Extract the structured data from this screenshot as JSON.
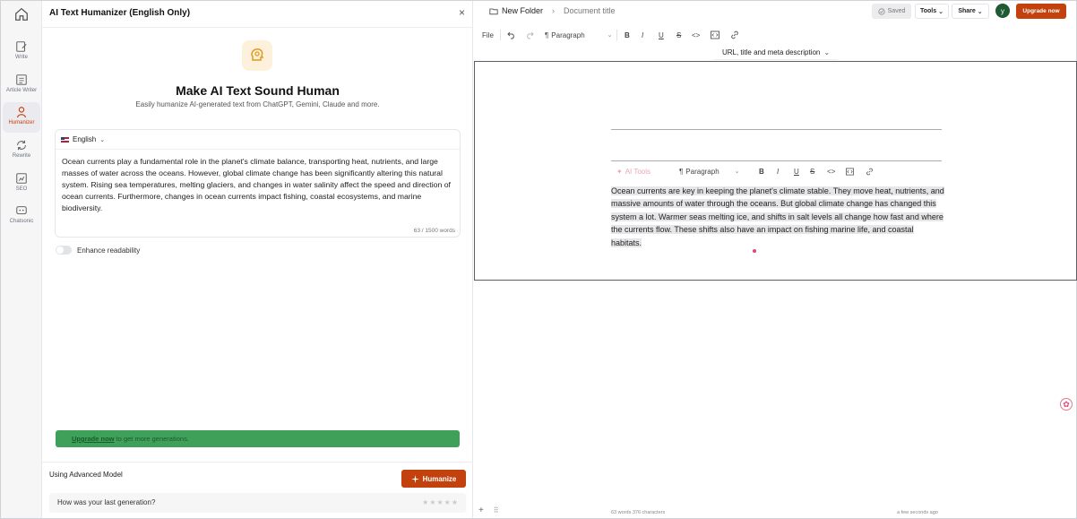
{
  "rail": {
    "items": [
      {
        "label": "Write",
        "icon": "write-icon"
      },
      {
        "label": "Article Writer",
        "icon": "article-icon"
      },
      {
        "label": "Humanizer",
        "icon": "humanizer-icon",
        "active": true
      },
      {
        "label": "Rewrite",
        "icon": "rewrite-icon"
      },
      {
        "label": "SEO",
        "icon": "seo-icon"
      },
      {
        "label": "Chatsonic",
        "icon": "chat-icon"
      }
    ]
  },
  "panel": {
    "title": "AI Text Humanizer (English Only)",
    "close": "×",
    "hero_title": "Make AI Text Sound Human",
    "hero_subtitle": "Easily humanize AI-generated text from ChatGPT, Gemini, Claude and more.",
    "language": "English",
    "input_text": "Ocean currents play a fundamental role in the planet's climate balance, transporting heat, nutrients, and large masses of water across the oceans. However, global climate change has been significantly altering this natural system. Rising sea temperatures, melting glaciers, and changes in water salinity affect the speed and direction of ocean currents. Furthermore, changes in ocean currents impact fishing, coastal ecosystems, and marine biodiversity.",
    "word_count": "63 / 1500 words",
    "enhance_label": "Enhance readability",
    "upgrade_link": "Upgrade now",
    "upgrade_rest": " to get more generations.",
    "advanced_model": "Using Advanced Model",
    "humanize_button": "Humanize",
    "feedback_question": "How was your last generation?",
    "stars": "★★★★★"
  },
  "header": {
    "folder": "New Folder",
    "separator": "›",
    "doc_title": "Document title",
    "saved": "Saved",
    "tools": "Tools",
    "share": "Share",
    "avatar_letter": "y",
    "upgrade_now": "Upgrade now"
  },
  "toolbar": {
    "file": "File",
    "paragraph": "Paragraph",
    "meta": "URL, title and meta description"
  },
  "editor": {
    "ai_tools": "AI Tools",
    "paragraph": "Paragraph",
    "text": "Ocean currents are key in keeping the planet's climate stable. They move heat, nutrients, and massive amounts of water through the oceans. But global climate change has changed this system a lot. Warmer seas melting ice, and shifts in salt levels all change how fast and where the currents flow. These shifts also have an impact on fishing marine life, and coastal habitats.",
    "status_words": "63 words  376 characters",
    "status_time": "a few seconds ago"
  },
  "colors": {
    "accent": "#c2410c",
    "banner": "#3fa05a",
    "avatar": "#1e5a32"
  }
}
